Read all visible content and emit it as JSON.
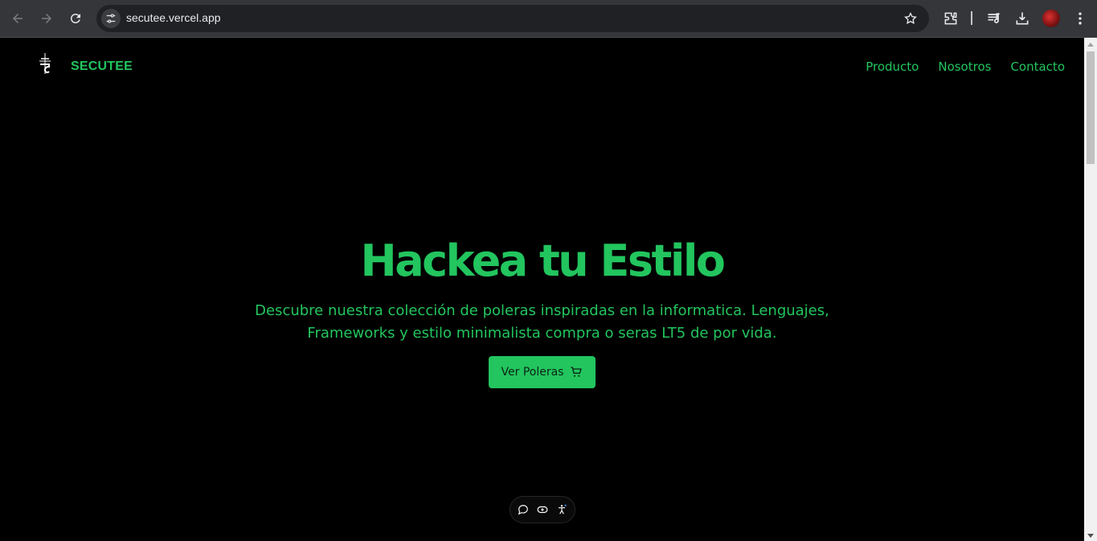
{
  "browser": {
    "url": "secutee.vercel.app"
  },
  "site": {
    "brand": "SECUTEE",
    "nav": [
      {
        "label": "Producto"
      },
      {
        "label": "Nosotros"
      },
      {
        "label": "Contacto"
      }
    ]
  },
  "hero": {
    "title": "Hackea tu Estilo",
    "subtitle_line1": "Descubre nuestra colección de poleras inspiradas en la informatica. Lenguajes,",
    "subtitle_line2": "Frameworks y estilo minimalista compra o seras LT5 de por vida.",
    "cta_label": "Ver Poleras",
    "cta_icon": "cart-icon"
  },
  "colors": {
    "accent": "#22c55e",
    "background": "#000000"
  },
  "floating_toolbar": {
    "icons": [
      "comment-icon",
      "eye-icon",
      "accessibility-icon"
    ]
  }
}
